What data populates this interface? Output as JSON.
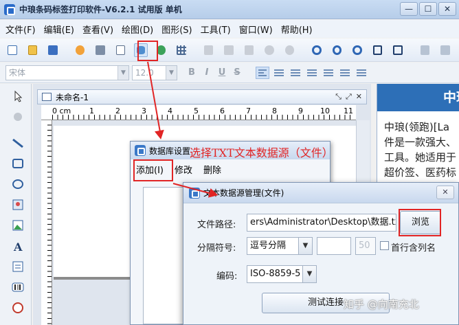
{
  "window": {
    "title": "中琅条码标签打印软件-V6.2.1 试用版 单机",
    "icon": "app-logo-icon",
    "controls": [
      "—",
      "☐",
      "✕"
    ]
  },
  "menu": [
    "文件(F)",
    "编辑(E)",
    "查看(V)",
    "绘图(D)",
    "图形(S)",
    "工具(T)",
    "窗口(W)",
    "帮助(H)"
  ],
  "toolbar": {
    "icons": [
      "new-icon",
      "open-icon",
      "save-icon",
      "settings-icon",
      "print-icon",
      "print-preview-icon",
      "database-icon",
      "database-link-icon",
      "grid-icon",
      "cut-icon",
      "copy-icon",
      "paste-icon",
      "undo-icon",
      "redo-icon",
      "zoom-in-icon",
      "zoom-out-icon",
      "zoom-icon",
      "fit-page-icon",
      "fit-width-icon",
      "align-left-icon",
      "align-center-icon"
    ]
  },
  "format_bar": {
    "font": "宋体",
    "size": "12.0",
    "bold": "B",
    "italic": "I",
    "underline": "U",
    "strikeout": "S"
  },
  "document": {
    "tab_title": "未命名-1",
    "ruler_numbers": [
      "0 cm",
      "1",
      "2",
      "3",
      "4",
      "5",
      "6",
      "7",
      "8",
      "9",
      "10",
      "11"
    ]
  },
  "right_panel": {
    "header": "中琅",
    "lines": [
      "中琅(领跑)[La",
      "件是一款强大、",
      "工具。她适用于",
      "超价签、医药标"
    ]
  },
  "db_dialog": {
    "title": "数据库设置",
    "menu": [
      "添加(I)",
      "修改",
      "删除"
    ]
  },
  "txt_dialog": {
    "title": "文本数据源管理(文件)",
    "path_label": "文件路径:",
    "path_value": "ers\\Administrator\\Desktop\\数据.txt",
    "browse": "浏览",
    "sep_label": "分隔符号:",
    "sep_value": "逗号分隔",
    "sep_custom_value": "",
    "sep_count": "50",
    "header_checkbox": "首行含列名",
    "enc_label": "编码:",
    "enc_value": "ISO-8859-5",
    "test_button": "测试连接"
  },
  "annotation": {
    "text": "选择TXT文本数据源（文件）",
    "color": "#e12424"
  },
  "watermark": "知乎 @向南充北"
}
